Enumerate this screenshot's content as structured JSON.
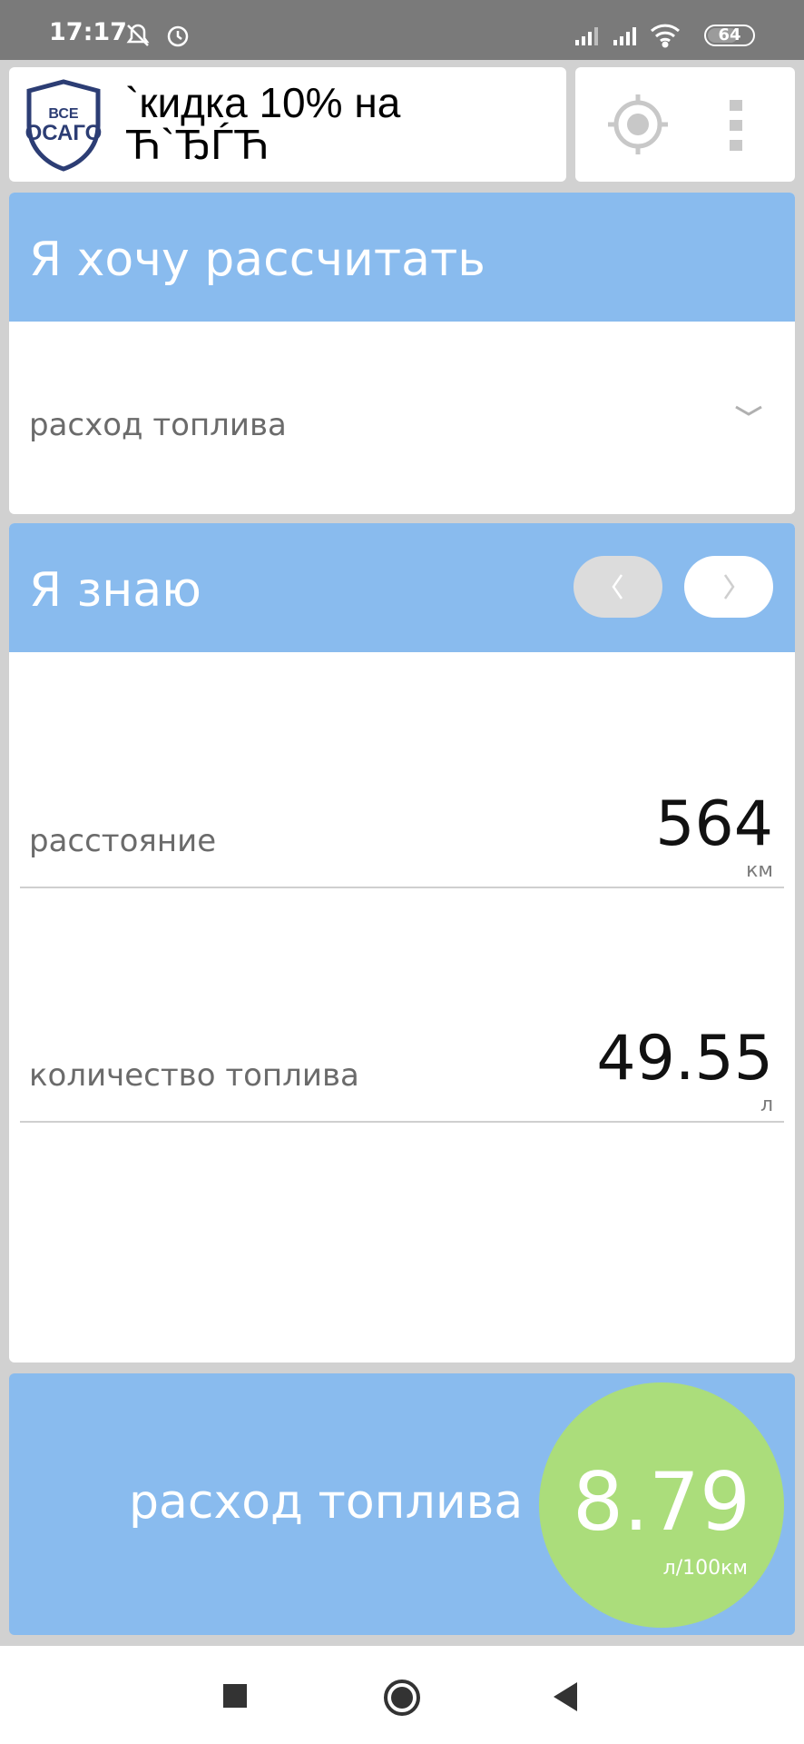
{
  "status_bar": {
    "time": "17:17",
    "battery": "64",
    "icons": [
      "mute-icon",
      "alarm-icon",
      "signal-icon",
      "signal-icon",
      "wifi-icon",
      "battery-icon"
    ]
  },
  "ad": {
    "logo_top": "ВСЕ",
    "logo_bottom": "ОСАГО",
    "text": "`кидка 10% на Ћ`ЂЃЋ"
  },
  "calculate": {
    "title": "Я хочу рассчитать",
    "selected": "расход топлива"
  },
  "known": {
    "title": "Я знаю",
    "fields": [
      {
        "label": "расстояние",
        "value": "564",
        "unit": "км"
      },
      {
        "label": "количество топлива",
        "value": "49.55",
        "unit": "л"
      }
    ]
  },
  "result": {
    "label": "расход топлива",
    "value": "8.79",
    "unit": "л/100км"
  },
  "colors": {
    "header_blue": "#89bbee",
    "result_green": "#abdd7b",
    "status_gray": "#7a7a7a"
  }
}
